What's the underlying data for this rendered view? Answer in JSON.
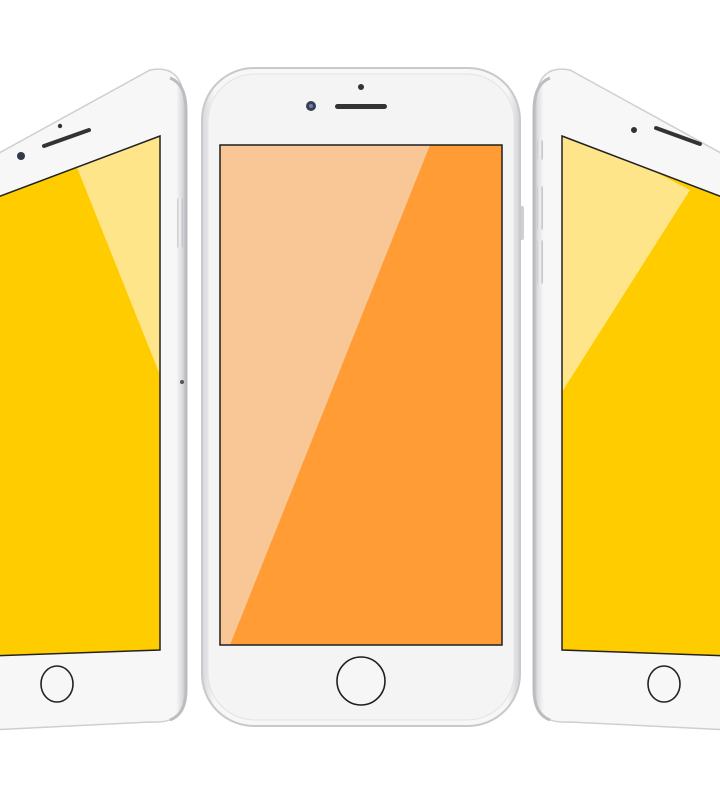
{
  "scene": {
    "description_label": "",
    "phones": [
      {
        "id": "left",
        "screen_color": "#FFCC00",
        "glare_color": "#FFE58A"
      },
      {
        "id": "center",
        "screen_color": "#FF9C35",
        "glare_color": "#F9C696"
      },
      {
        "id": "right",
        "screen_color": "#FFCC00",
        "glare_color": "#FFE58A"
      }
    ],
    "colors": {
      "body": "#F3F3F4",
      "frame": "#D9D9DC",
      "background": "#FFFFFF"
    },
    "icons": [
      "camera-icon",
      "speaker-icon",
      "sensor-icon",
      "home-button-icon"
    ]
  }
}
